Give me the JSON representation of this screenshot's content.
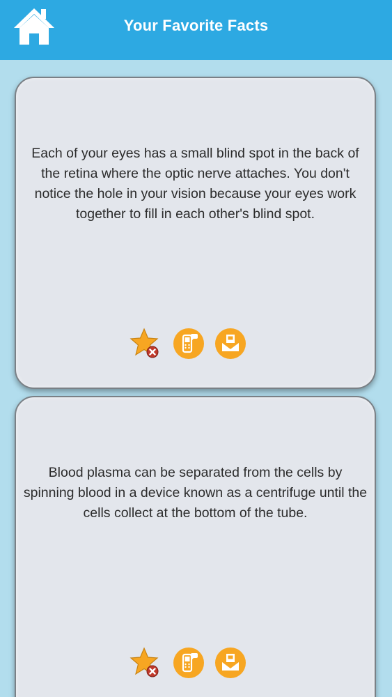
{
  "header": {
    "title": "Your Favorite Facts",
    "home_icon": "home-icon",
    "color": "#2da9e2"
  },
  "facts": [
    {
      "text": "Each of your eyes has a small blind spot in the back of the retina where the optic nerve attaches. You don't notice the hole in your vision because your eyes work together to fill in each other's blind spot.",
      "actions": [
        "unfavorite-star-icon",
        "sms-phone-icon",
        "email-envelope-icon"
      ]
    },
    {
      "text": "Blood plasma can be separated from the cells by spinning blood in a device known as a centrifuge until the cells collect at the bottom of the tube.",
      "actions": [
        "unfavorite-star-icon",
        "sms-phone-icon",
        "email-envelope-icon"
      ]
    }
  ],
  "colors": {
    "background": "#b2dded",
    "card": "#e3e6ec",
    "action_orange": "#f7a622",
    "remove_red": "#c0392b"
  }
}
